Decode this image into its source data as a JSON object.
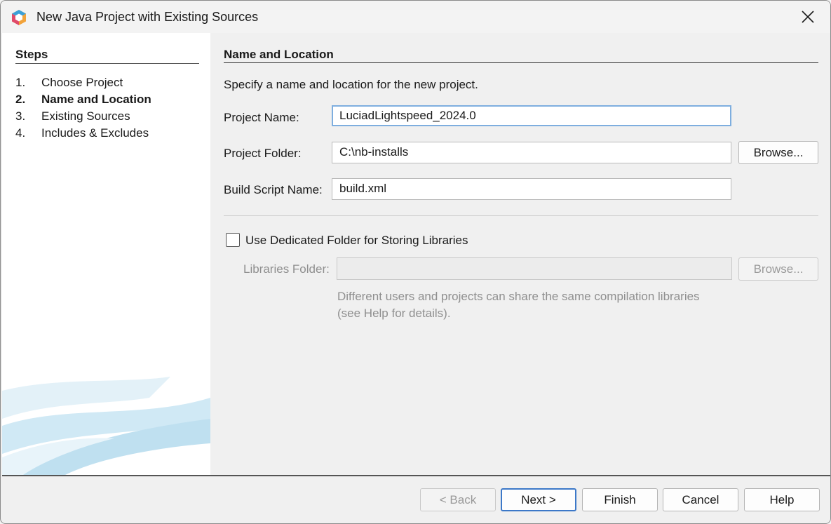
{
  "window": {
    "title": "New Java Project with Existing Sources",
    "app_icon": "netbeans-icon",
    "close_icon": "close-icon"
  },
  "steps": {
    "header": "Steps",
    "items": [
      {
        "num": "1.",
        "label": "Choose Project",
        "current": false
      },
      {
        "num": "2.",
        "label": "Name and Location",
        "current": true
      },
      {
        "num": "3.",
        "label": "Existing Sources",
        "current": false
      },
      {
        "num": "4.",
        "label": "Includes & Excludes",
        "current": false
      }
    ]
  },
  "main": {
    "title": "Name and Location",
    "intro": "Specify a name and location for the new project.",
    "project_name_label": "Project Name:",
    "project_name_value": "LuciadLightspeed_2024.0",
    "project_folder_label": "Project Folder:",
    "project_folder_value": "C:\\nb-installs",
    "browse_label": "Browse...",
    "build_script_label": "Build Script Name:",
    "build_script_value": "build.xml",
    "dedicated_folder_label": "Use Dedicated Folder for Storing Libraries",
    "dedicated_folder_checked": false,
    "libraries_folder_label": "Libraries Folder:",
    "libraries_folder_value": "",
    "libraries_browse_label": "Browse...",
    "help_line1": "Different users and projects can share the same compilation libraries",
    "help_line2": "(see Help for details)."
  },
  "footer": {
    "back_label": "< Back",
    "next_label": "Next >",
    "finish_label": "Finish",
    "cancel_label": "Cancel",
    "help_label": "Help"
  }
}
